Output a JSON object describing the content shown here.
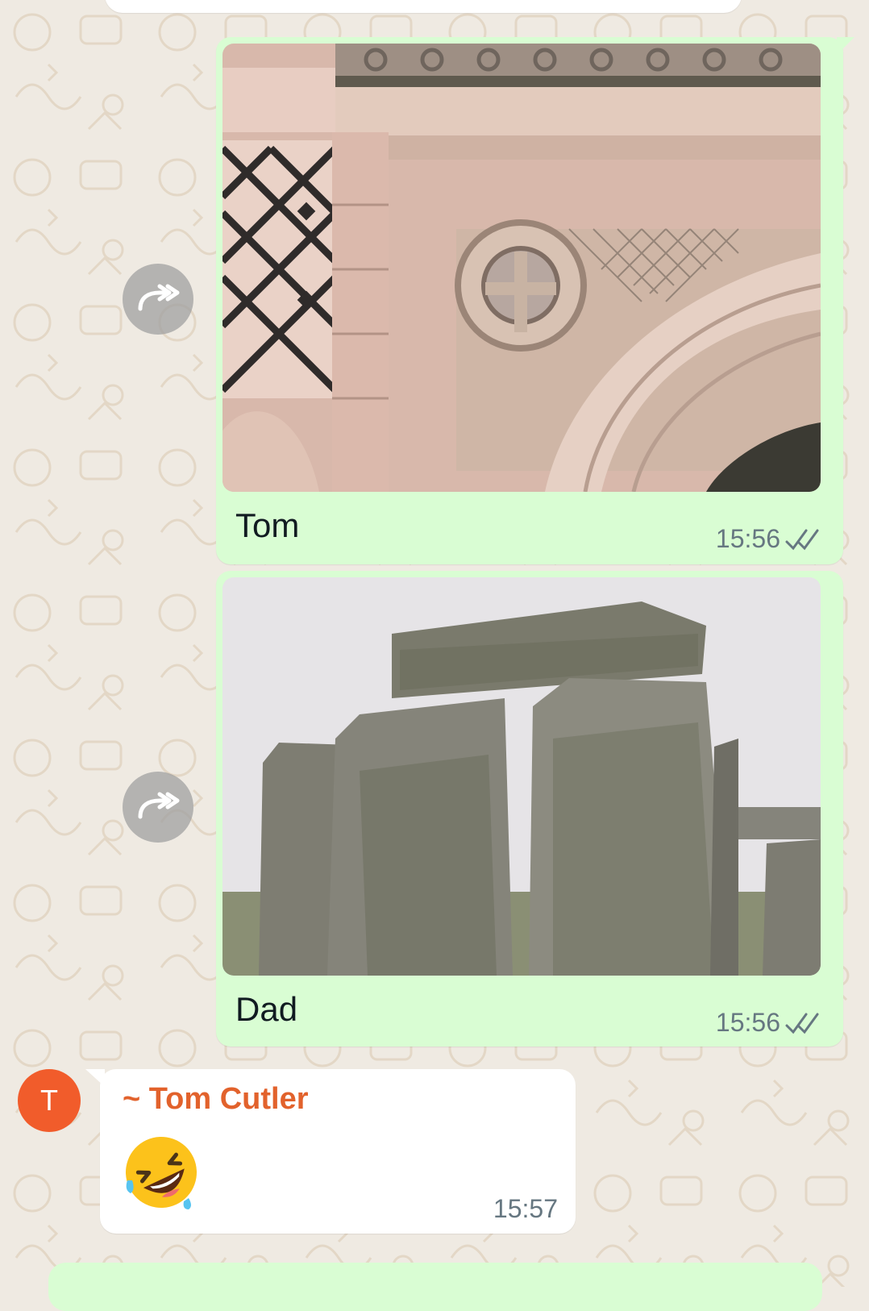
{
  "messages": [
    {
      "type": "image",
      "direction": "outgoing",
      "caption": "Tom",
      "time": "15:56",
      "status": "read-double-check"
    },
    {
      "type": "image",
      "direction": "outgoing",
      "caption": "Dad",
      "time": "15:56",
      "status": "read-double-check"
    },
    {
      "type": "emoji",
      "direction": "incoming",
      "sender": "~ Tom Cutler",
      "avatar_letter": "T",
      "emoji": "rolling-on-floor-laughing",
      "time": "15:57"
    }
  ],
  "colors": {
    "outgoing_bubble": "#d9fdd3",
    "incoming_bubble": "#ffffff",
    "wallpaper": "#efeae2",
    "sender_name": "#e2622c",
    "avatar": "#f15c2b",
    "read_ticks": "#667781"
  },
  "icons": [
    "forward-icon",
    "double-check-icon",
    "rolling-laughing-emoji"
  ]
}
